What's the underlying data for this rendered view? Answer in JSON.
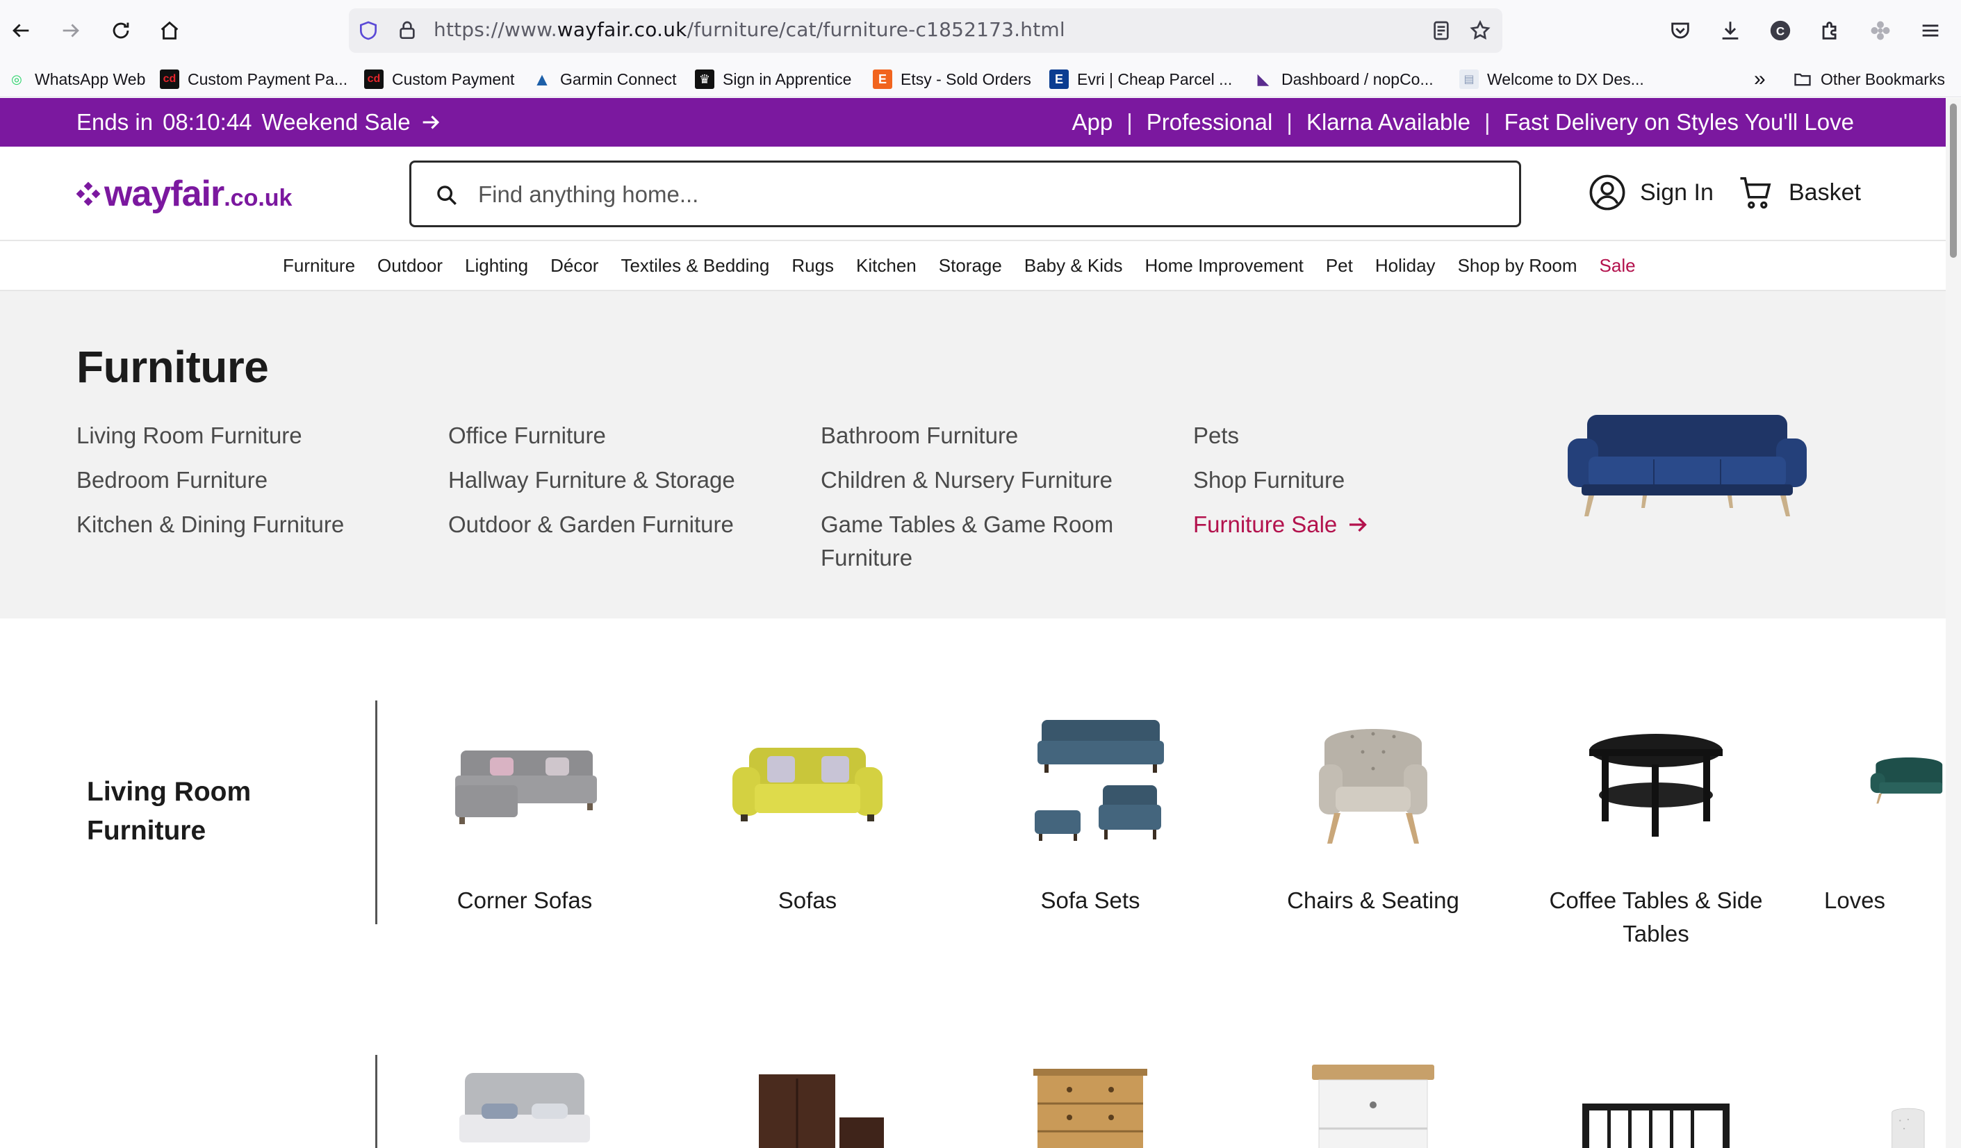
{
  "browser": {
    "url_prefix": "https://www.",
    "url_host": "wayfair.co.uk",
    "url_path": "/furniture/cat/furniture-c1852173.html",
    "profile_initial": "C",
    "bookmarks": [
      {
        "label": "WhatsApp Web",
        "icon": "whatsapp-icon",
        "color": "#25d366"
      },
      {
        "label": "Custom Payment Pa...",
        "icon": "cd-icon",
        "color": "#c4161c"
      },
      {
        "label": "Custom Payment",
        "icon": "cd-icon",
        "color": "#c4161c"
      },
      {
        "label": "Garmin Connect",
        "icon": "garmin-triangle-icon",
        "color": "#1d5fa8"
      },
      {
        "label": "Sign in Apprentice",
        "icon": "crown-icon",
        "color": "#111111"
      },
      {
        "label": "Etsy - Sold Orders",
        "icon": "etsy-icon",
        "color": "#f1641e"
      },
      {
        "label": "Evri | Cheap Parcel ...",
        "icon": "evri-icon",
        "color": "#0b3d91"
      },
      {
        "label": "Dashboard / nopCo...",
        "icon": "nopcommerce-icon",
        "color": "#5b2d8e"
      },
      {
        "label": "Welcome to DX Des...",
        "icon": "page-icon",
        "color": "#8a9bb8"
      }
    ],
    "other_bookmarks": "Other Bookmarks"
  },
  "promo": {
    "ends_label": "Ends in",
    "timer": "08:10:44",
    "sale_label": "Weekend Sale",
    "links": [
      "App",
      "Professional",
      "Klarna Available",
      "Fast Delivery on Styles You'll Love"
    ]
  },
  "header": {
    "logo_word": "wayfair",
    "logo_tld": ".co.uk",
    "search_placeholder": "Find anything home...",
    "sign_in": "Sign In",
    "basket": "Basket",
    "brand_color": "#7b189f"
  },
  "nav": {
    "items": [
      "Furniture",
      "Outdoor",
      "Lighting",
      "Décor",
      "Textiles & Bedding",
      "Rugs",
      "Kitchen",
      "Storage",
      "Baby & Kids",
      "Home Improvement",
      "Pet",
      "Holiday",
      "Shop by Room"
    ],
    "sale": "Sale",
    "sale_color": "#b3124d"
  },
  "hero": {
    "title": "Furniture",
    "columns": [
      [
        "Living Room Furniture",
        "Bedroom Furniture",
        "Kitchen & Dining Furniture"
      ],
      [
        "Office Furniture",
        "Hallway Furniture & Storage",
        "Outdoor & Garden Furniture"
      ],
      [
        "Bathroom Furniture",
        "Children & Nursery Furniture",
        "Game Tables & Game Room Furniture"
      ],
      [
        "Pets",
        "Shop Furniture"
      ]
    ],
    "sale_link": "Furniture Sale"
  },
  "living_room": {
    "title": "Living Room Furniture",
    "tiles": [
      "Corner Sofas",
      "Sofas",
      "Sofa Sets",
      "Chairs & Seating",
      "Coffee Tables & Side Tables",
      "Loves"
    ]
  }
}
